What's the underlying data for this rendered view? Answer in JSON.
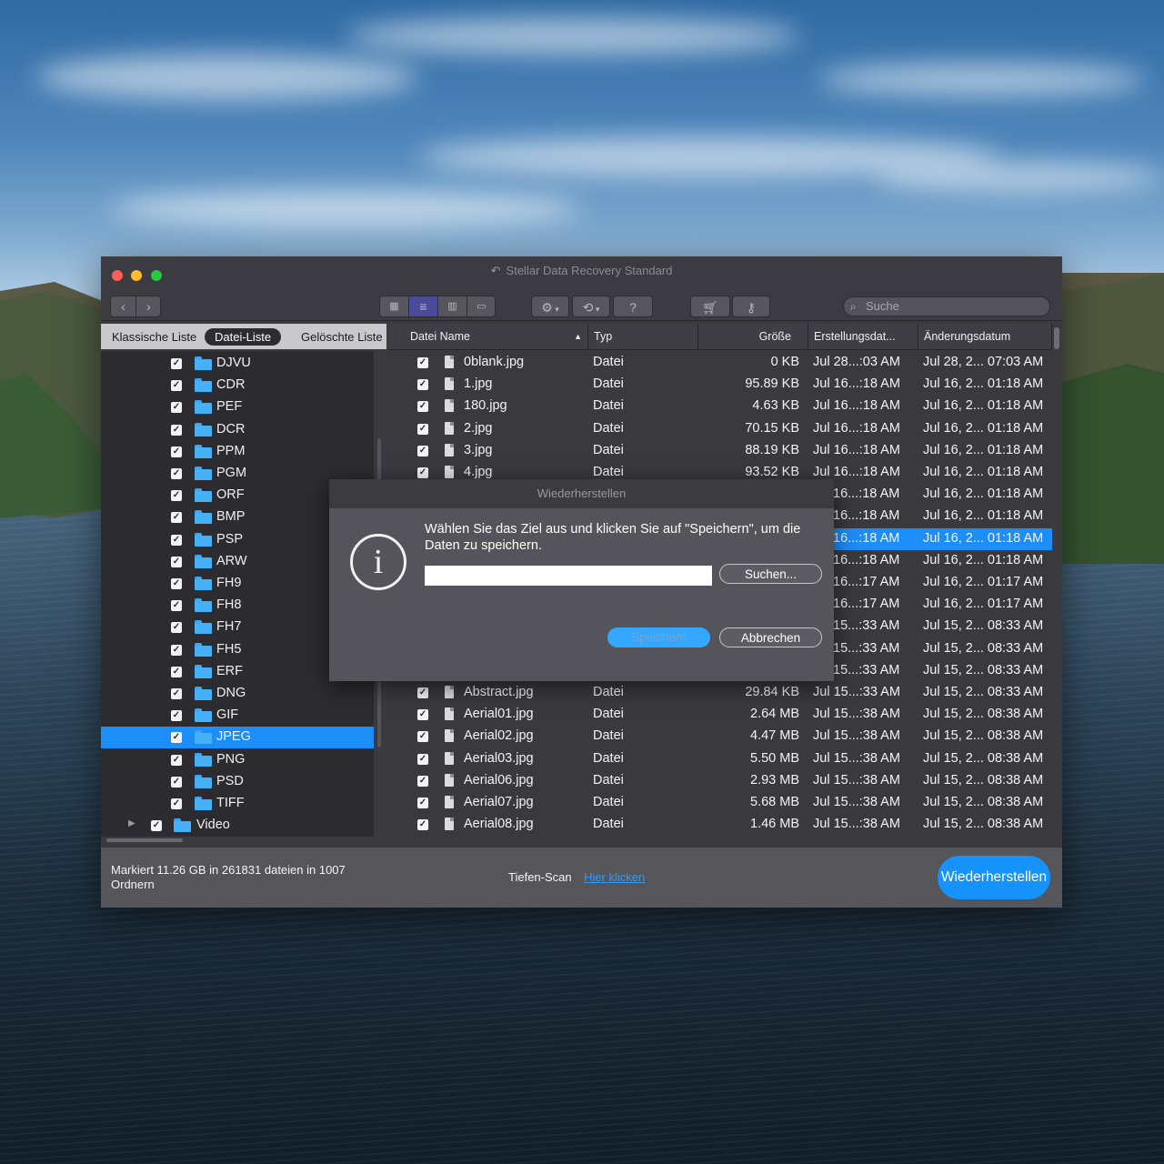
{
  "window": {
    "title": "Stellar Data Recovery Standard",
    "title_icon": "undo-arrow-icon",
    "traffic_colors": {
      "close": "#ff5f57",
      "minimize": "#febc2e",
      "maximize": "#28c840"
    }
  },
  "toolbar": {
    "search_placeholder": "Suche",
    "help_label": "?"
  },
  "left_tabs": {
    "classic": "Klassische Liste",
    "file_list": "Datei-Liste",
    "deleted": "Gelöschte Liste"
  },
  "tree": {
    "items": [
      {
        "label": "DJVU"
      },
      {
        "label": "CDR"
      },
      {
        "label": "PEF"
      },
      {
        "label": "DCR"
      },
      {
        "label": "PPM"
      },
      {
        "label": "PGM"
      },
      {
        "label": "ORF"
      },
      {
        "label": "BMP"
      },
      {
        "label": "PSP"
      },
      {
        "label": "ARW"
      },
      {
        "label": "FH9"
      },
      {
        "label": "FH8"
      },
      {
        "label": "FH7"
      },
      {
        "label": "FH5"
      },
      {
        "label": "ERF"
      },
      {
        "label": "DNG"
      },
      {
        "label": "GIF"
      },
      {
        "label": "JPEG"
      },
      {
        "label": "PNG"
      },
      {
        "label": "PSD"
      },
      {
        "label": "TIFF"
      },
      {
        "label": "Video"
      }
    ],
    "selected": "JPEG"
  },
  "table": {
    "columns": {
      "name": "Datei Name",
      "type": "Typ",
      "size": "Größe",
      "created": "Erstellungsdat...",
      "modified": "Änderungsdatum"
    },
    "rows": [
      {
        "name": "0blank.jpg",
        "type": "Datei",
        "size": "0  KB",
        "created": "Jul 28...:03 AM",
        "modified": "Jul 28, 2... 07:03 AM"
      },
      {
        "name": "1.jpg",
        "type": "Datei",
        "size": "95.89 KB",
        "created": "Jul 16...:18 AM",
        "modified": "Jul 16, 2... 01:18 AM"
      },
      {
        "name": "180.jpg",
        "type": "Datei",
        "size": "4.63 KB",
        "created": "Jul 16...:18 AM",
        "modified": "Jul 16, 2... 01:18 AM"
      },
      {
        "name": "2.jpg",
        "type": "Datei",
        "size": "70.15 KB",
        "created": "Jul 16...:18 AM",
        "modified": "Jul 16, 2... 01:18 AM"
      },
      {
        "name": "3.jpg",
        "type": "Datei",
        "size": "88.19 KB",
        "created": "Jul 16...:18 AM",
        "modified": "Jul 16, 2... 01:18 AM"
      },
      {
        "name": "4.jpg",
        "type": "Datei",
        "size": "93.52 KB",
        "created": "Jul 16...:18 AM",
        "modified": "Jul 16, 2... 01:18 AM"
      },
      {
        "name": "",
        "type": "",
        "size": "",
        "created": "16...:18 AM",
        "modified": "Jul 16, 2... 01:18 AM"
      },
      {
        "name": "",
        "type": "",
        "size": "",
        "created": "16...:18 AM",
        "modified": "Jul 16, 2... 01:18 AM"
      },
      {
        "name": "",
        "type": "",
        "size": "",
        "created": "16...:18 AM",
        "modified": "Jul 16, 2... 01:18 AM"
      },
      {
        "name": "",
        "type": "",
        "size": "",
        "created": "16...:18 AM",
        "modified": "Jul 16, 2... 01:18 AM"
      },
      {
        "name": "",
        "type": "",
        "size": "",
        "created": "16...:17 AM",
        "modified": "Jul 16, 2... 01:17 AM"
      },
      {
        "name": "",
        "type": "",
        "size": "",
        "created": "16...:17 AM",
        "modified": "Jul 16, 2... 01:17 AM"
      },
      {
        "name": "",
        "type": "",
        "size": "",
        "created": "15...:33 AM",
        "modified": "Jul 15, 2... 08:33 AM"
      },
      {
        "name": "",
        "type": "",
        "size": "",
        "created": "15...:33 AM",
        "modified": "Jul 15, 2... 08:33 AM"
      },
      {
        "name": "",
        "type": "",
        "size": "",
        "created": "15...:33 AM",
        "modified": "Jul 15, 2... 08:33 AM"
      },
      {
        "name": "Abstract.jpg",
        "type": "Datei",
        "size": "29.84 KB",
        "created": "Jul 15...:33 AM",
        "modified": "Jul 15, 2... 08:33 AM"
      },
      {
        "name": "Aerial01.jpg",
        "type": "Datei",
        "size": "2.64 MB",
        "created": "Jul 15...:38 AM",
        "modified": "Jul 15, 2... 08:38 AM"
      },
      {
        "name": "Aerial02.jpg",
        "type": "Datei",
        "size": "4.47 MB",
        "created": "Jul 15...:38 AM",
        "modified": "Jul 15, 2... 08:38 AM"
      },
      {
        "name": "Aerial03.jpg",
        "type": "Datei",
        "size": "5.50 MB",
        "created": "Jul 15...:38 AM",
        "modified": "Jul 15, 2... 08:38 AM"
      },
      {
        "name": "Aerial06.jpg",
        "type": "Datei",
        "size": "2.93 MB",
        "created": "Jul 15...:38 AM",
        "modified": "Jul 15, 2... 08:38 AM"
      },
      {
        "name": "Aerial07.jpg",
        "type": "Datei",
        "size": "5.68 MB",
        "created": "Jul 15...:38 AM",
        "modified": "Jul 15, 2... 08:38 AM"
      },
      {
        "name": "Aerial08.jpg",
        "type": "Datei",
        "size": "1.46 MB",
        "created": "Jul 15...:38 AM",
        "modified": "Jul 15, 2... 08:38 AM"
      }
    ],
    "selected_row": 8
  },
  "dialog": {
    "title": "Wiederherstellen",
    "message": "Wählen Sie das Ziel aus und klicken Sie auf \"Speichern\", um die Daten zu speichern.",
    "input_value": "",
    "browse_label": "Suchen...",
    "save_label": "Speichern",
    "cancel_label": "Abbrechen",
    "icon": "info-icon"
  },
  "footer": {
    "status": "Markiert 11.26 GB in 261831 dateien in 1007 Ordnern",
    "deep_scan_label": "Tiefen-Scan",
    "deep_scan_link": "Hier klicken",
    "recover_label": "Wiederherstellen"
  }
}
